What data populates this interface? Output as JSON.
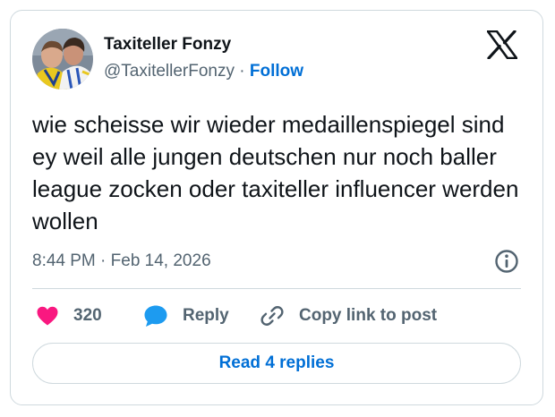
{
  "author": {
    "display_name": "Taxiteller Fonzy",
    "handle": "@TaxitellerFonzy",
    "separator": "·",
    "follow_label": "Follow"
  },
  "logo": {
    "icon": "x-logo-icon"
  },
  "tweet": {
    "text": "wie scheisse wir wieder medaillenspiegel sind ey weil alle jungen deutschen nur noch baller league zocken oder taxiteller influencer werden wollen",
    "time": "8:44 PM",
    "separator": "·",
    "date": "Feb 14, 2026"
  },
  "actions": {
    "like_count": "320",
    "reply_label": "Reply",
    "copy_label": "Copy link to post"
  },
  "footer": {
    "read_replies_label": "Read 4 replies"
  },
  "colors": {
    "accent": "#006fd6",
    "like": "#f91880",
    "reply": "#1d9bf0",
    "text": "#0f1419",
    "muted": "#536471",
    "border": "#cfd9de"
  }
}
